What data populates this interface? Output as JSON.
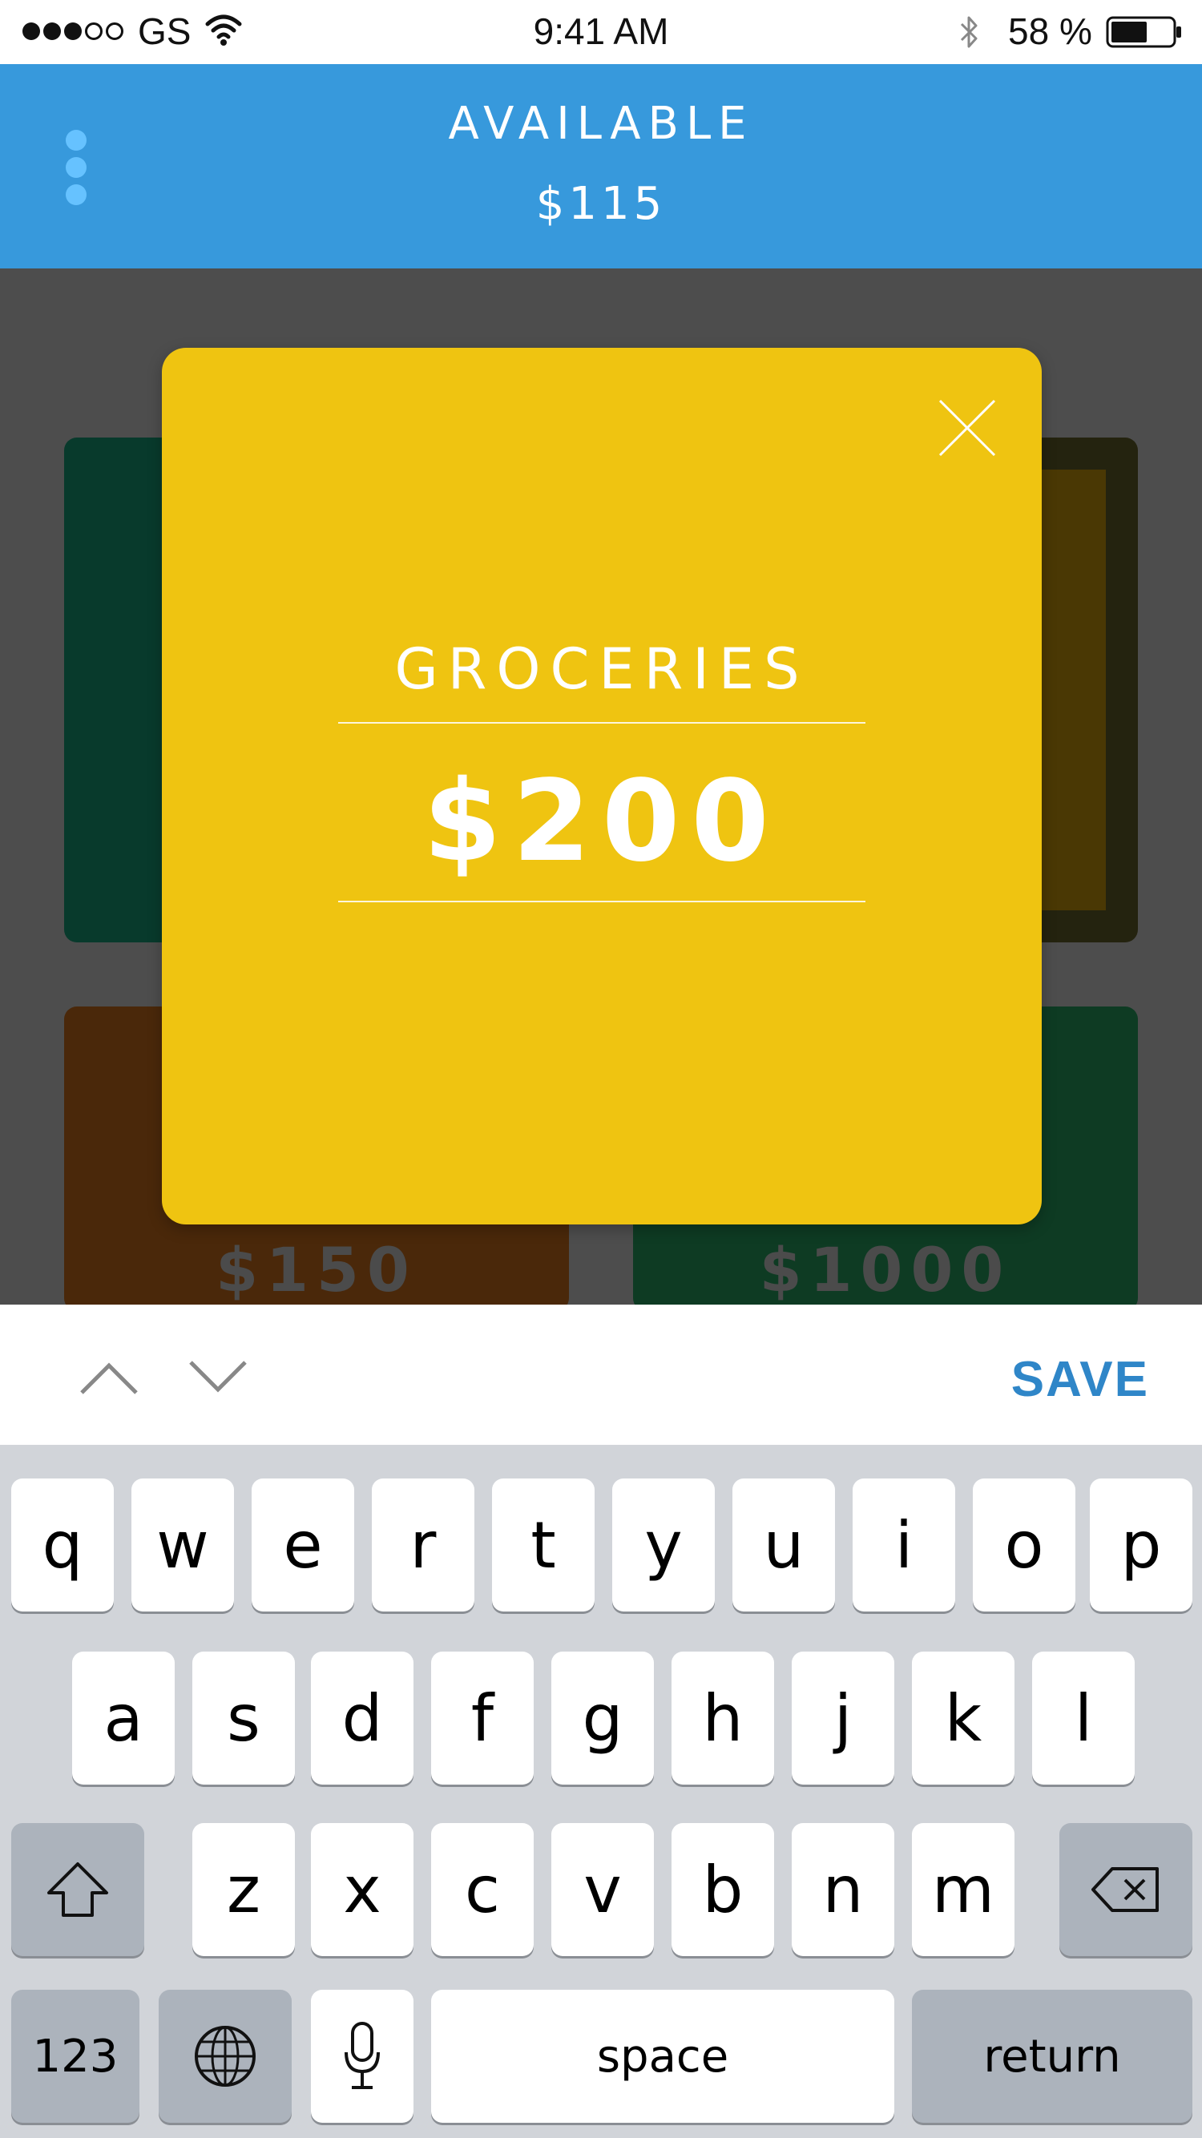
{
  "status_bar": {
    "carrier": "GS",
    "time": "9:41 AM",
    "battery": "58 %"
  },
  "header": {
    "label": "AVAILABLE",
    "amount": "$115",
    "menu_icon": "vertical-dots-icon"
  },
  "background_cards": [
    {
      "color": "#083a2c"
    },
    {
      "color": "#4a3804"
    },
    {
      "color": "#4a280a",
      "amount": "$150"
    },
    {
      "color": "#0e3b23",
      "amount": "$1000"
    }
  ],
  "modal": {
    "category": "GROCERIES",
    "amount": "$200",
    "close_icon": "close-icon",
    "background": "#efc411"
  },
  "accessory_bar": {
    "save_label": "SAVE",
    "up_icon": "chevron-up-icon",
    "down_icon": "chevron-down-icon"
  },
  "keyboard": {
    "row1": [
      "q",
      "w",
      "e",
      "r",
      "t",
      "y",
      "u",
      "i",
      "o",
      "p"
    ],
    "row2": [
      "a",
      "s",
      "d",
      "f",
      "g",
      "h",
      "j",
      "k",
      "l"
    ],
    "row3": [
      "z",
      "x",
      "c",
      "v",
      "b",
      "n",
      "m"
    ],
    "numbers_label": "123",
    "space_label": "space",
    "return_label": "return"
  }
}
